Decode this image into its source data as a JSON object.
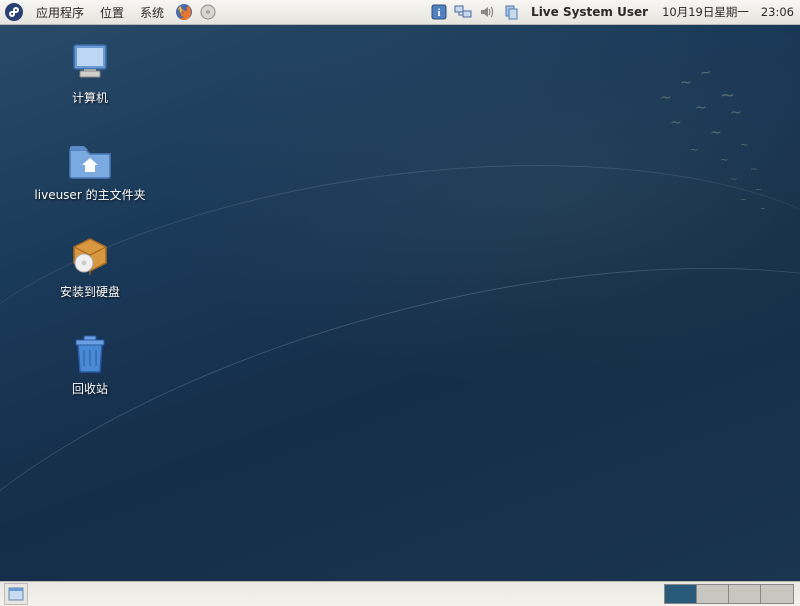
{
  "top_panel": {
    "menus": {
      "applications": "应用程序",
      "places": "位置",
      "system": "系统"
    },
    "user": "Live System User",
    "date": "10月19日星期一",
    "time": "23:06"
  },
  "desktop_icons": {
    "computer": "计算机",
    "home": "liveuser 的主文件夹",
    "install": "安装到硬盘",
    "trash": "回收站"
  },
  "workspaces": {
    "count": 4,
    "active": 0
  }
}
